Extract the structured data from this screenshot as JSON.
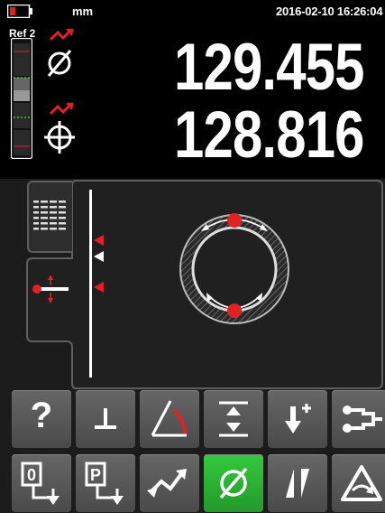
{
  "status": {
    "unit": "mm",
    "datetime": "2016-02-10 16:26:04",
    "battery_icon": "battery-low-icon",
    "battery_color": "#e22222"
  },
  "readout": {
    "ref_label": "Ref 2",
    "value_1": "129.455",
    "value_2": "128.816",
    "symbol_1": "diameter-icon",
    "symbol_2": "position-crosshair-icon",
    "accent_color": "#e22222"
  },
  "panel": {
    "tabs": [
      "list-view-tab",
      "probe-settings-tab"
    ],
    "diagram": "circle-bore-measurement"
  },
  "toolbar": {
    "row_1": [
      {
        "name": "help-button",
        "icon": "question-mark-icon",
        "label": "?"
      },
      {
        "name": "perpendicular-button",
        "icon": "perpendicular-icon"
      },
      {
        "name": "angle-button",
        "icon": "angle-icon"
      },
      {
        "name": "distance-button",
        "icon": "distance-icon"
      },
      {
        "name": "step-down-button",
        "icon": "arrow-down-plus-icon"
      },
      {
        "name": "probe-button",
        "icon": "probe-icon"
      }
    ],
    "row_2": [
      {
        "name": "zero-button",
        "icon": "zero-reference-icon",
        "label": "0"
      },
      {
        "name": "preset-button",
        "icon": "preset-reference-icon",
        "label": "P"
      },
      {
        "name": "curve-button",
        "icon": "curve-arrows-icon"
      },
      {
        "name": "diameter-button",
        "icon": "diameter-icon",
        "active": true
      },
      {
        "name": "taper-button",
        "icon": "taper-icon"
      },
      {
        "name": "triangle-rotate-button",
        "icon": "rotate-triangle-icon"
      }
    ]
  }
}
